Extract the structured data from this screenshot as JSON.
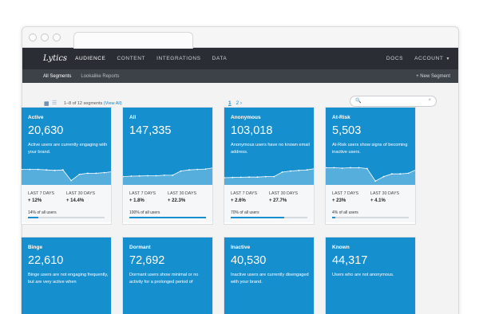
{
  "nav": {
    "logo": "Lytics",
    "items": [
      "AUDIENCE",
      "CONTENT",
      "INTEGRATIONS",
      "DATA"
    ],
    "right": [
      "DOCS",
      "ACCOUNT"
    ]
  },
  "subnav": {
    "items": [
      "All Segments",
      "Lookalike Reports"
    ],
    "new_segment": "+ New Segment"
  },
  "toolbar": {
    "count_prefix": "1–8 of 12 segments",
    "view_all": "(View All)",
    "page_current": "1",
    "page_next": "2",
    "next_arrow": "›"
  },
  "colors": {
    "accent": "#168fcf",
    "nav_bg": "#2a2d33"
  },
  "cards": [
    {
      "title": "Active",
      "count": "20,630",
      "desc": "Active users are currently engaging with your brand.",
      "last7_label": "LAST 7 DAYS",
      "last7": "+ 12%",
      "last30_label": "LAST 30 DAYS",
      "last30": "+ 14.4%",
      "pct_label": "14% of all users",
      "pct": 0.14,
      "trend": [
        0.62,
        0.62,
        0.62,
        0.6,
        0.58,
        0.6,
        0.12,
        0.4,
        0.45,
        0.45,
        0.48,
        0.52
      ]
    },
    {
      "title": "All",
      "count": "147,335",
      "desc": "",
      "last7_label": "LAST 7 DAYS",
      "last7": "+ 1.8%",
      "last30_label": "LAST 30 DAYS",
      "last30": "+ 22.3%",
      "pct_label": "100% of all users",
      "pct": 1.0,
      "trend": [
        0.3,
        0.32,
        0.33,
        0.34,
        0.34,
        0.36,
        0.36,
        0.55,
        0.6,
        0.62,
        0.64,
        0.7
      ]
    },
    {
      "title": "Anonymous",
      "count": "103,018",
      "desc": "Anonymous users have no known email address.",
      "last7_label": "LAST 7 DAYS",
      "last7": "+ 2.6%",
      "last30_label": "LAST 30 DAYS",
      "last30": "+ 27.7%",
      "pct_label": "70% of all users",
      "pct": 0.7,
      "trend": [
        0.25,
        0.26,
        0.27,
        0.28,
        0.28,
        0.3,
        0.3,
        0.5,
        0.55,
        0.58,
        0.6,
        0.66
      ]
    },
    {
      "title": "At-Risk",
      "count": "5,503",
      "desc": "At-Risk users show signs of becoming inactive users.",
      "last7_label": "LAST 7 DAYS",
      "last7": "+ 23%",
      "last30_label": "LAST 30 DAYS",
      "last30": "+ 4.1%",
      "pct_label": "4% of all users",
      "pct": 0.04,
      "trend": [
        0.7,
        0.7,
        0.68,
        0.7,
        0.7,
        0.66,
        0.1,
        0.3,
        0.42,
        0.42,
        0.45,
        0.62
      ]
    },
    {
      "title": "Binge",
      "count": "22,610",
      "desc": "Binge users are not engaging frequently, but are very active when",
      "last7_label": "",
      "last7": "",
      "last30_label": "",
      "last30": "",
      "pct_label": "",
      "pct": 0,
      "trend": []
    },
    {
      "title": "Dormant",
      "count": "72,692",
      "desc": "Dormant users show minimal or no activity for a prolonged period of",
      "last7_label": "",
      "last7": "",
      "last30_label": "",
      "last30": "",
      "pct_label": "",
      "pct": 0,
      "trend": []
    },
    {
      "title": "Inactive",
      "count": "40,530",
      "desc": "Inactive users are currently disengaged with your brand.",
      "last7_label": "",
      "last7": "",
      "last30_label": "",
      "last30": "",
      "pct_label": "",
      "pct": 0,
      "trend": []
    },
    {
      "title": "Known",
      "count": "44,317",
      "desc": "Users who are not anonymous.",
      "last7_label": "",
      "last7": "",
      "last30_label": "",
      "last30": "",
      "pct_label": "",
      "pct": 0,
      "trend": []
    }
  ]
}
